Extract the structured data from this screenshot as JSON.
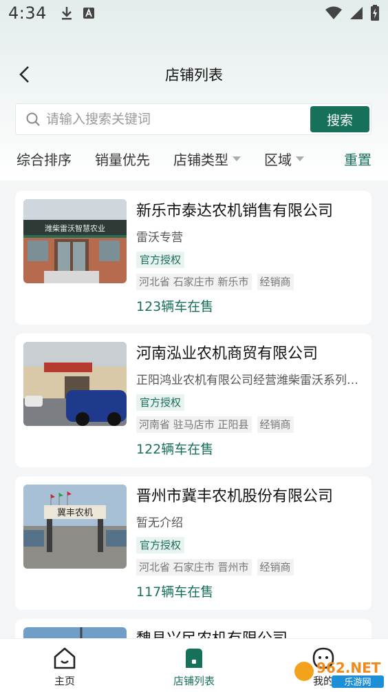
{
  "status_bar": {
    "time": "4:34",
    "left_icons": [
      "download-icon",
      "a-notification-icon"
    ],
    "right_icons": [
      "wifi-icon",
      "signal-icon",
      "battery-icon"
    ]
  },
  "header": {
    "title": "店铺列表"
  },
  "search": {
    "placeholder": "请输入搜索关键词",
    "button_label": "搜索"
  },
  "filters": {
    "comprehensive": "综合排序",
    "sales": "销量优先",
    "shop_type": "店铺类型",
    "region": "区域",
    "reset": "重置"
  },
  "shops": [
    {
      "name": "新乐市泰达农机销售有限公司",
      "desc": "雷沃专营",
      "badge": "官方授权",
      "location": "河北省 石家庄市 新乐市",
      "type": "经销商",
      "cars": "123辆车在售",
      "sign_text": "潍柴雷沃智慧农业"
    },
    {
      "name": "河南泓业农机商贸有限公司",
      "desc": "正阳鸿业农机有限公司经营潍柴雷沃系列…",
      "badge": "官方授权",
      "location": "河南省 驻马店市 正阳县",
      "type": "经销商",
      "cars": "122辆车在售"
    },
    {
      "name": "晋州市冀丰农机股份有限公司",
      "desc": "暂无介绍",
      "badge": "官方授权",
      "location": "河北省 石家庄市 晋州市",
      "type": "经销商",
      "cars": "117辆车在售",
      "sign_text": "冀丰农机"
    },
    {
      "name": "魏县兴民农机有限公司"
    }
  ],
  "tabbar": {
    "home": "主页",
    "shops": "店铺列表",
    "mine": "我的"
  },
  "watermark": {
    "text_top": "962.NET",
    "text_bottom": "乐游网"
  },
  "colors": {
    "accent": "#17705a",
    "badge_bg": "#e9f3f0"
  }
}
